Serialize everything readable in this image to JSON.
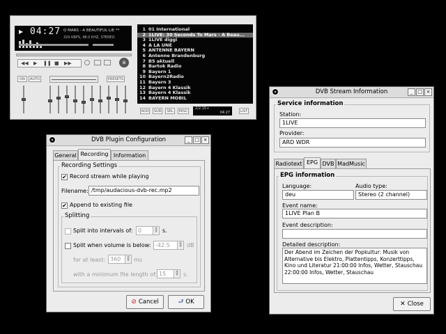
{
  "player": {
    "time": "04:27",
    "track_title": "O MARS - A BEAUTIFUL LIE **",
    "stream_info": "320 KBPS, 48.0 KHZ, STEREO",
    "eq_on_label": "ON",
    "eq_auto_label": "AUTO",
    "eq_presets_label": "PRESETS",
    "playlist": [
      {
        "num": "1",
        "name": "01 International"
      },
      {
        "num": "2",
        "name": "1LIVE: 30 Seconds To Mars - A Beau..."
      },
      {
        "num": "3",
        "name": "1LIVE diggi"
      },
      {
        "num": "4",
        "name": "A LA UNE"
      },
      {
        "num": "5",
        "name": "ANTENNE BAYERN"
      },
      {
        "num": "6",
        "name": "Antenne Brandenburg"
      },
      {
        "num": "7",
        "name": "B5 aktuell"
      },
      {
        "num": "8",
        "name": "Bartok Radio"
      },
      {
        "num": "9",
        "name": "Bayern 1"
      },
      {
        "num": "10",
        "name": "Bayern2Radio"
      },
      {
        "num": "11",
        "name": "Bayern 3"
      },
      {
        "num": "12",
        "name": "Bayern 4 Klassik"
      },
      {
        "num": "13",
        "name": "Bayern 4 Klassik"
      },
      {
        "num": "14",
        "name": "BAYERN MOBIL"
      }
    ],
    "pl_add": "ADD",
    "pl_sub": "SUB",
    "pl_sel": "SEL",
    "pl_misc": "MISC",
    "pl_list": "LIST",
    "pl_pos": "2/2:15+",
    "pl_time": "04:27",
    "playlist_selected": "2"
  },
  "plugin_config": {
    "title": "DVB Plugin Configuration",
    "tabs": [
      "General",
      "Recording",
      "Information"
    ],
    "active_tab": "Recording",
    "recording_settings_label": "Recording Settings",
    "record_stream_label": "Record stream while playing",
    "record_stream_checked": true,
    "filename_label": "Filename:",
    "filename_value": "/tmp/audacious-dvb-rec.mp2",
    "append_label": "Append to existing file",
    "append_checked": true,
    "splitting_label": "Splitting",
    "split_intervals_label": "Split into intervals of:",
    "split_intervals_value": "0",
    "split_intervals_unit": "s.",
    "split_volume_label": "Split when volume is below:",
    "split_volume_value": "-42.5",
    "split_volume_unit": "dB",
    "at_least_label": "for at least:",
    "at_least_value": "360",
    "at_least_unit": "ms",
    "min_length_label": "with a minimum file length of:",
    "min_length_value": "15",
    "min_length_unit": "s.",
    "cancel_label": "Cancel",
    "ok_label": "OK"
  },
  "stream_info": {
    "title": "DVB Stream Information",
    "service_info_label": "Service information",
    "station_label": "Station:",
    "station_value": "1LIVE",
    "provider_label": "Provider:",
    "provider_value": "ARD WDR",
    "tabs": [
      "Radiotext",
      "EPG",
      "DVB",
      "MadMusic"
    ],
    "active_tab": "EPG",
    "epg_info_label": "EPG information",
    "language_label": "Language:",
    "language_value": "deu",
    "audio_type_label": "Audio type:",
    "audio_type_value": "Stereo (2 channel)",
    "event_name_label": "Event name:",
    "event_name_value": "1LIVE Plan B",
    "event_desc_label": "Event description:",
    "event_desc_value": "",
    "detailed_desc_label": "Detailed description:",
    "detailed_desc_value": "Der Abend im Zeichen der Popkultur: Musik von Alternative bis Elektro, Plattentipps, Konzerttipps, Kino und Literatur 21:00:00 Infos, Wetter, Stauschau 22:00:00 Infos, Wetter, Stauschau",
    "close_label": "Close"
  }
}
